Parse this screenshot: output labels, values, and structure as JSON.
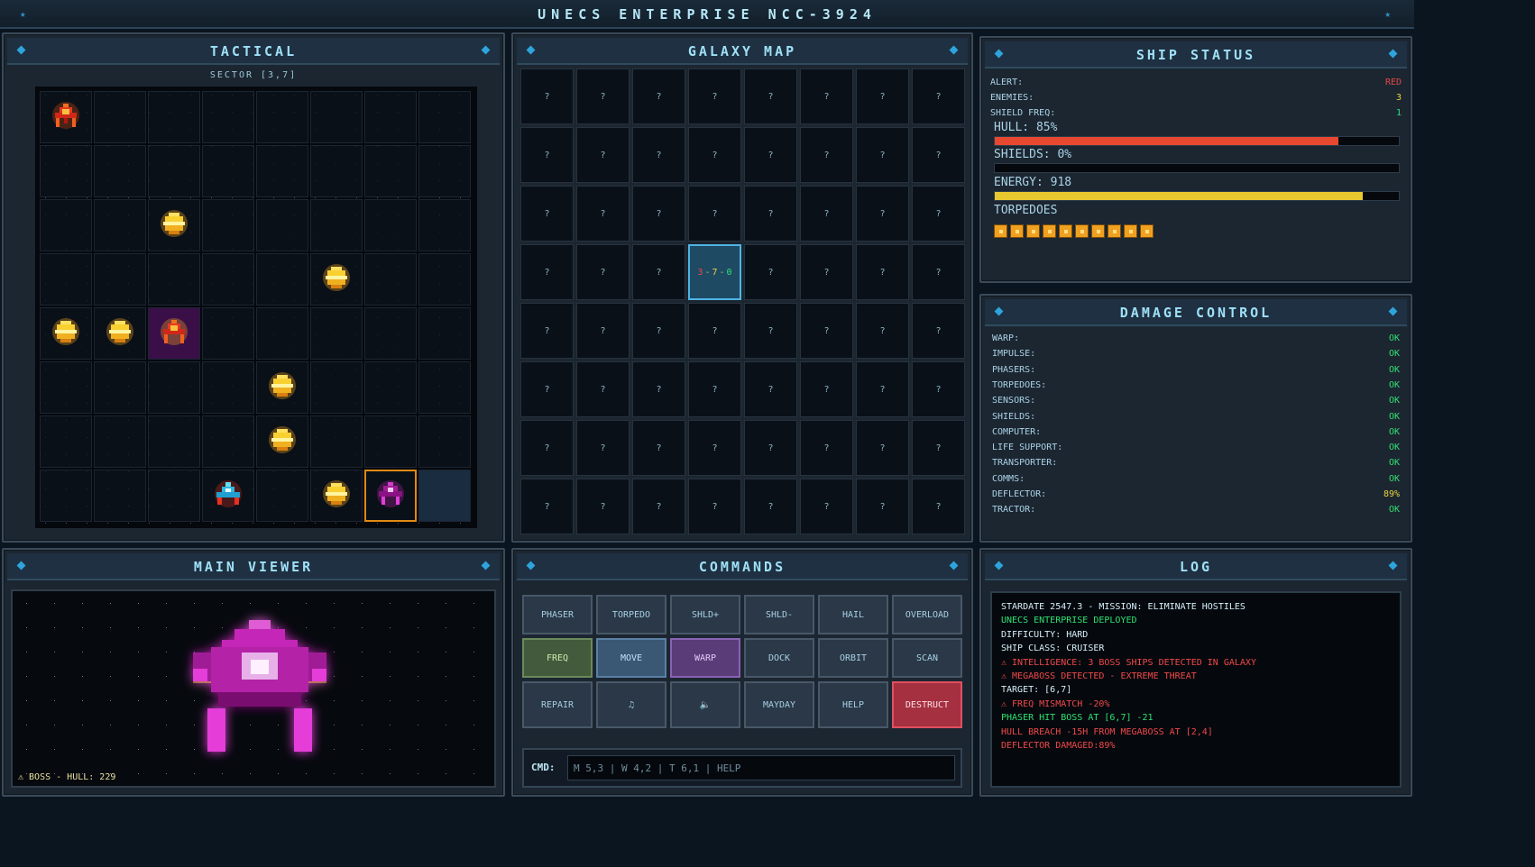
{
  "title": "UNECS ENTERPRISE NCC-3924",
  "colors": {
    "bg": "#0b1520",
    "accent": "#2ea4dc",
    "alert_red": "#e04848",
    "ok_green": "#30e070",
    "warn_yellow": "#e8d440"
  },
  "tactical": {
    "title": "TACTICAL",
    "sector_label": "SECTOR [3,7]",
    "entities": [
      {
        "row": 0,
        "col": 0,
        "type": "enemy-red"
      },
      {
        "row": 2,
        "col": 2,
        "type": "star"
      },
      {
        "row": 3,
        "col": 5,
        "type": "star"
      },
      {
        "row": 4,
        "col": 0,
        "type": "star"
      },
      {
        "row": 4,
        "col": 1,
        "type": "star"
      },
      {
        "row": 4,
        "col": 2,
        "type": "boss-red"
      },
      {
        "row": 5,
        "col": 4,
        "type": "star"
      },
      {
        "row": 6,
        "col": 4,
        "type": "star"
      },
      {
        "row": 7,
        "col": 3,
        "type": "player"
      },
      {
        "row": 7,
        "col": 5,
        "type": "star"
      },
      {
        "row": 7,
        "col": 6,
        "type": "megaboss"
      }
    ],
    "selected_cell": {
      "row": 7,
      "col": 6
    },
    "highlight_cell": {
      "row": 7,
      "col": 7
    }
  },
  "galaxy": {
    "title": "GALAXY MAP",
    "unknown_symbol": "?",
    "current": {
      "row": 3,
      "col": 3
    },
    "current_label": [
      "3",
      "-",
      "7",
      "-",
      "0"
    ]
  },
  "status": {
    "title": "SHIP STATUS",
    "alert_label": "ALERT:",
    "alert_value": "RED",
    "enemies_label": "ENEMIES:",
    "enemies_value": "3",
    "freq_label": "SHIELD FREQ:",
    "freq_value": "1",
    "hull_label": "HULL: 85%",
    "hull_pct": 85,
    "shields_label": "SHIELDS: 0%",
    "shields_pct": 0,
    "energy_label": "ENERGY: 918",
    "energy_pct": 91,
    "torpedoes_label": "TORPEDOES",
    "torpedoes_count": 10
  },
  "damage": {
    "title": "DAMAGE CONTROL",
    "systems": [
      {
        "name": "WARP:",
        "value": "OK"
      },
      {
        "name": "IMPULSE:",
        "value": "OK"
      },
      {
        "name": "PHASERS:",
        "value": "OK"
      },
      {
        "name": "TORPEDOES:",
        "value": "OK"
      },
      {
        "name": "SENSORS:",
        "value": "OK"
      },
      {
        "name": "SHIELDS:",
        "value": "OK"
      },
      {
        "name": "COMPUTER:",
        "value": "OK"
      },
      {
        "name": "LIFE SUPPORT:",
        "value": "OK"
      },
      {
        "name": "TRANSPORTER:",
        "value": "OK"
      },
      {
        "name": "COMMS:",
        "value": "OK"
      },
      {
        "name": "DEFLECTOR:",
        "value": "89%"
      },
      {
        "name": "TRACTOR:",
        "value": "OK"
      }
    ]
  },
  "viewer": {
    "title": "MAIN VIEWER",
    "caption": "⚠ BOSS - HULL: 229"
  },
  "commands": {
    "title": "COMMANDS",
    "buttons": [
      {
        "label": "PHASER",
        "style": ""
      },
      {
        "label": "TORPEDO",
        "style": ""
      },
      {
        "label": "SHLD+",
        "style": ""
      },
      {
        "label": "SHLD-",
        "style": ""
      },
      {
        "label": "HAIL",
        "style": ""
      },
      {
        "label": "OVERLOAD",
        "style": ""
      },
      {
        "label": "FREQ",
        "style": "green"
      },
      {
        "label": "MOVE",
        "style": "blue"
      },
      {
        "label": "WARP",
        "style": "violet"
      },
      {
        "label": "DOCK",
        "style": ""
      },
      {
        "label": "ORBIT",
        "style": ""
      },
      {
        "label": "SCAN",
        "style": ""
      },
      {
        "label": "REPAIR",
        "style": ""
      },
      {
        "label": "♫",
        "style": "",
        "name": "music"
      },
      {
        "label": "🔈",
        "style": "",
        "name": "sound"
      },
      {
        "label": "MAYDAY",
        "style": ""
      },
      {
        "label": "HELP",
        "style": ""
      },
      {
        "label": "DESTRUCT",
        "style": "red"
      }
    ],
    "cmd_label": "CMD:",
    "cmd_placeholder": "M 5,3 | W 4,2 | T 6,1 | HELP"
  },
  "log": {
    "title": "LOG",
    "lines": [
      {
        "text": "STARDATE 2547.3 - MISSION: ELIMINATE HOSTILES",
        "color": "#d6eef8"
      },
      {
        "text": "UNECS ENTERPRISE DEPLOYED",
        "color": "#30e070"
      },
      {
        "text": "DIFFICULTY: HARD",
        "color": "#d6eef8"
      },
      {
        "text": "SHIP CLASS: CRUISER",
        "color": "#d6eef8"
      },
      {
        "text": "⚠ INTELLIGENCE: 3 BOSS SHIPS DETECTED IN GALAXY",
        "color": "#f04848"
      },
      {
        "text": "⚠ MEGABOSS DETECTED - EXTREME THREAT",
        "color": "#f04848"
      },
      {
        "text": "TARGET: [6,7]",
        "color": "#d6eef8"
      },
      {
        "text": "⚠ FREQ MISMATCH -20%",
        "color": "#f04848"
      },
      {
        "text": "PHASER HIT BOSS AT [6,7] -21",
        "color": "#30e070"
      },
      {
        "text": "HULL BREACH -15H FROM MEGABOSS AT [2,4]",
        "color": "#f04848"
      },
      {
        "text": "DEFLECTOR DAMAGED:89%",
        "color": "#f04848"
      }
    ]
  }
}
